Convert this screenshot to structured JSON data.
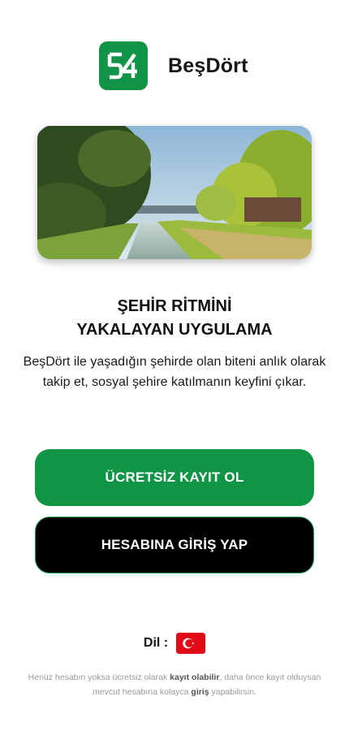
{
  "brand": {
    "name": "BeşDört",
    "logo_icon": "besdort-logo-icon"
  },
  "hero": {
    "image_icon": "city-canal-landscape-image"
  },
  "headline": {
    "line1": "ŞEHİR RİTMİNİ",
    "line2": "YAKALAYAN UYGULAMA"
  },
  "subtitle": "BeşDört ile yaşadığın şehirde olan biteni anlık olarak takip et, sosyal şehire katılmanın keyfini çıkar.",
  "buttons": {
    "register_label": "ÜCRETSİZ KAYIT OL",
    "login_label": "HESABINA GİRİŞ YAP"
  },
  "language": {
    "label": "Dil :",
    "flag_icon": "turkey-flag-icon"
  },
  "footer": {
    "part1": "Henüz hesabın yoksa ücretsiz olarak ",
    "link_register": "kayıt olabilir",
    "part2": ", daha önce kayıt olduysan mevcut hesabına kolayca ",
    "link_login": "giriş",
    "part3": " yapabilirsin."
  },
  "colors": {
    "primary_green": "#0f9545",
    "login_bg": "#000000",
    "flag_red": "#e30a17"
  }
}
